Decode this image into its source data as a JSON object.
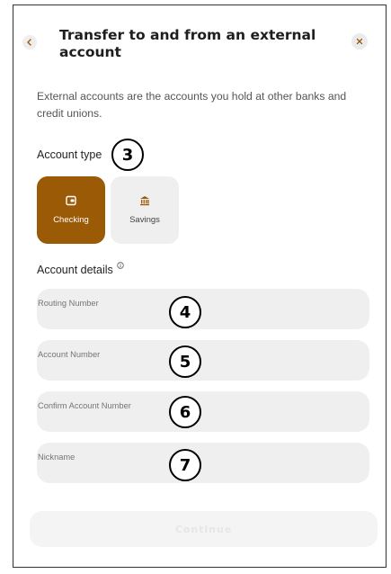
{
  "header": {
    "title": "Transfer to and from an external account",
    "back_icon": "chevron-left-icon",
    "close_icon": "close-icon"
  },
  "description": "External accounts are the accounts you hold at other banks and credit unions.",
  "account_type": {
    "label": "Account type",
    "options": [
      {
        "label": "Checking",
        "icon": "wallet-icon",
        "selected": true
      },
      {
        "label": "Savings",
        "icon": "bank-icon",
        "selected": false
      }
    ]
  },
  "account_details": {
    "label": "Account details",
    "info_icon": "info-icon",
    "fields": [
      {
        "placeholder": "Routing Number",
        "value": ""
      },
      {
        "placeholder": "Account Number",
        "value": ""
      },
      {
        "placeholder": "Confirm Account Number",
        "value": ""
      },
      {
        "placeholder": "Nickname",
        "value": ""
      }
    ]
  },
  "annotations": [
    "3",
    "4",
    "5",
    "6",
    "7"
  ],
  "continue_button": {
    "label": "Continue",
    "enabled": false
  },
  "colors": {
    "accent": "#9a5a06",
    "field_background": "#efefef",
    "text_primary": "#1e1e1e",
    "text_secondary": "#555555"
  }
}
